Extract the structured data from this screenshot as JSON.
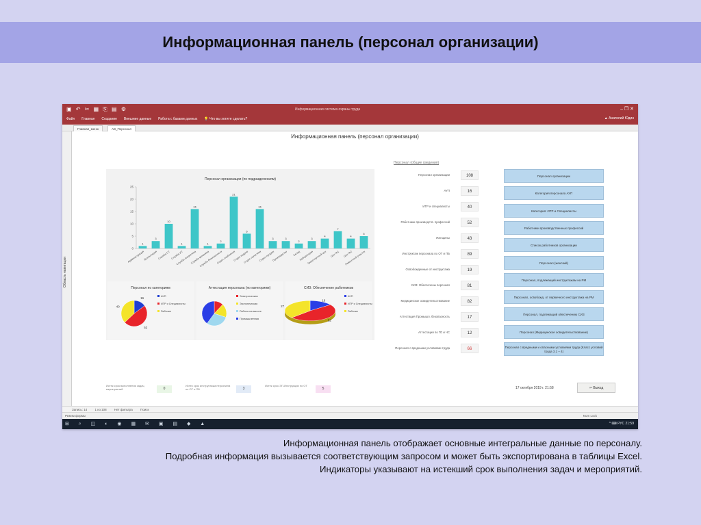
{
  "slide": {
    "title": "Информационная панель (персонал организации)",
    "caption": [
      "Информационная панель отображает основные интегральные данные по персоналу.",
      "Подробная информация вызывается соответствующим запросом и может быть экспортирована в таблицы Excel.",
      "Индикаторы указывают на истекший срок выполнения задач и мероприятий."
    ]
  },
  "app": {
    "qat_icons": "▣ ↶ ✂ ▦ ⎘ ▤ ⚙",
    "window_title": "Информационная система охраны труда",
    "window_controls": "–  ❐  ✕",
    "menu": [
      "Файл",
      "Главная",
      "Создание",
      "Внешние данные",
      "Работа с базами данных"
    ],
    "tell_me": "Что вы хотите сделать?",
    "user": "Анатолий Юдин",
    "doc_tabs": [
      "Главная_меню",
      "AB_Персонал"
    ],
    "nav_pane_label": "Область навигации",
    "form_title": "Информационная панель (персонал организации)"
  },
  "chart_data": [
    {
      "type": "bar",
      "title": "Персонал организации (по подразделениям)",
      "ylim": [
        0,
        25
      ],
      "yticks": [
        0,
        5,
        10,
        15,
        20,
        25
      ],
      "values": [
        1,
        3,
        10,
        1,
        16,
        1,
        2,
        21,
        6,
        16,
        3,
        3,
        2,
        3,
        4,
        7,
        4,
        5
      ],
      "data_labels": [
        "1",
        "3",
        "10",
        "1",
        "16",
        "1",
        "2",
        "21",
        "6",
        "16",
        "3",
        "3",
        "2",
        "3",
        "4",
        "7",
        "4",
        "5"
      ],
      "categories": [
        "Администрация",
        "Бухгалтерия",
        "Служба ОТ",
        "Служба ИТ",
        "Служба энергетика",
        "Служба механика",
        "Служба безопасности",
        "Отдел снабжения",
        "Отдел кадров",
        "Отдел логистики",
        "Отдел продаж",
        "Производство",
        "Склад",
        "Лаборатория",
        "Транспортный цех",
        "Цех №1",
        "Цех №2",
        "Ремонтный участок"
      ],
      "color": "#3ec6c8",
      "grid": false
    },
    {
      "type": "pie",
      "title": "Персонал по категориям",
      "values": [
        16,
        52,
        40
      ],
      "data_labels": [
        "16",
        "52",
        "40"
      ],
      "legend": [
        "АУП",
        "ИТР и Специалисты",
        "Рабочие"
      ],
      "colors": [
        "#1f3ed0",
        "#e8242a",
        "#f4e42a"
      ]
    },
    {
      "type": "pie",
      "title": "Аттестация персонала (по категориям)",
      "values": [
        12,
        18,
        30,
        40
      ],
      "legend": [
        "Электрическая",
        "Экологическая",
        "Работы на высоте",
        "Промышленная"
      ],
      "colors": [
        "#e8242a",
        "#f4e42a",
        "#9fd8ef",
        "#2b3ee6"
      ]
    },
    {
      "type": "pie",
      "title": "СИЗ: Обеспечение работников",
      "values": [
        16,
        52,
        40
      ],
      "data_labels": [
        "16",
        "52",
        "27"
      ],
      "legend": [
        "АУП",
        "ИТР и Специалисты",
        "Рабочие"
      ],
      "colors": [
        "#2b3ee6",
        "#e8242a",
        "#f4e42a"
      ]
    }
  ],
  "stats": {
    "header": "Персонал (общие сведения)",
    "rows": [
      {
        "label": "Персонал организации",
        "value": "108"
      },
      {
        "label": "АУП",
        "value": "16"
      },
      {
        "label": "ИТР и специалисты",
        "value": "40"
      },
      {
        "label": "Работники производств. профессий",
        "value": "52"
      },
      {
        "label": "Женщины",
        "value": "43"
      },
      {
        "label": "Инструктаж персонала по ОТ и ПБ",
        "value": "89"
      },
      {
        "label": "Освобожденные от инструктажа",
        "value": "19"
      },
      {
        "label": "СИЗ: Обеспечены персонал",
        "value": "81"
      },
      {
        "label": "Медицинское освидетельствование",
        "value": "82"
      },
      {
        "label": "Аттестация Промышл. безопасность",
        "value": "17"
      },
      {
        "label": "Аттестация по ГО и ЧС",
        "value": "12"
      },
      {
        "label": "Персонал с вредными условиями труда",
        "value": "66"
      }
    ]
  },
  "buttons": [
    "Персонал организации",
    "Категория персонала АУП",
    "Категория: ИТР и Специалисты",
    "Работники производственных профессий",
    "Список работников организации",
    "Персонал (женский)",
    "Персонал, подлежащий инструктажам на РМ",
    "Персонал, освобожд. от первичного инструктажа на РМ",
    "Персонал, подлежащий обеспечению СИЗ",
    "Персонал (Медицинское освидетельствование)",
    "Персонал с вредными и опасными условиями труда (Класс условий труда 3.1 – 4)"
  ],
  "indicators": [
    {
      "label": "Истек срок выполнения задач, мероприятий",
      "value": "0",
      "bg": "#e9f6e6"
    },
    {
      "label": "Истек срок инструктажа персонала по ОТ и ПБ",
      "value": "3",
      "bg": "#e2ebf7"
    },
    {
      "label": "Истек срок ЭП-Инструкции по ОТ",
      "value": "5",
      "bg": "#f8dff2"
    }
  ],
  "datetime": "17 октября 2019 г.   21:58",
  "exit_label": "Выход",
  "record_nav": {
    "record": "Запись: 14",
    "of": "1 из 108",
    "filter": "Нет фильтра",
    "search": "Поиск"
  },
  "status": {
    "mode": "Режим формы",
    "numlock": "Num Lock"
  },
  "taskbar": {
    "icons": "⊞ ⌕ ◫ ◐ ◉ ▦ ✉ ▣ ▤ ◆ ▲",
    "tray": "^  ⌨  РУС  21:59"
  }
}
